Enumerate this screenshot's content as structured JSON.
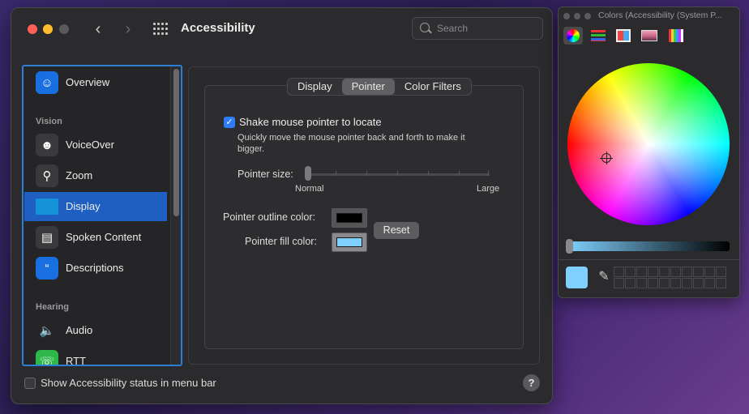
{
  "window": {
    "title": "Accessibility",
    "search_placeholder": "Search"
  },
  "sidebar": {
    "items": [
      {
        "label": "Overview",
        "icon": "overview-icon",
        "color": "#1a6fe0"
      },
      {
        "label": "VoiceOver",
        "icon": "voiceover-icon",
        "color": "#3a3a3c"
      },
      {
        "label": "Zoom",
        "icon": "zoom-icon",
        "color": "#3a3a3c"
      },
      {
        "label": "Display",
        "icon": "display-icon",
        "color": "#1593d8",
        "selected": true
      },
      {
        "label": "Spoken Content",
        "icon": "spoken-content-icon",
        "color": "#3a3a3c"
      },
      {
        "label": "Descriptions",
        "icon": "descriptions-icon",
        "color": "#1a6fe0"
      },
      {
        "label": "Audio",
        "icon": "audio-icon",
        "color": "#2b2b2d"
      },
      {
        "label": "RTT",
        "icon": "rtt-icon",
        "color": "#2eb84a"
      }
    ],
    "headings": {
      "vision": "Vision",
      "hearing": "Hearing"
    }
  },
  "tabs": [
    {
      "label": "Display",
      "active": false
    },
    {
      "label": "Pointer",
      "active": true
    },
    {
      "label": "Color Filters",
      "active": false
    }
  ],
  "pointer": {
    "shake_label": "Shake mouse pointer to locate",
    "shake_checked": true,
    "shake_desc": "Quickly move the mouse pointer back and forth to make it bigger.",
    "size_label": "Pointer size:",
    "size_min": "Normal",
    "size_max": "Large",
    "size_value": 0,
    "outline_label": "Pointer outline color:",
    "outline_color": "#000000",
    "fill_label": "Pointer fill color:",
    "fill_color": "#7fd0ff",
    "reset_label": "Reset"
  },
  "footer": {
    "status_label": "Show Accessibility status in menu bar",
    "status_checked": false,
    "help_label": "?"
  },
  "colors_panel": {
    "title": "Colors (Accessibility (System P...",
    "current_color": "#7fd0ff"
  }
}
